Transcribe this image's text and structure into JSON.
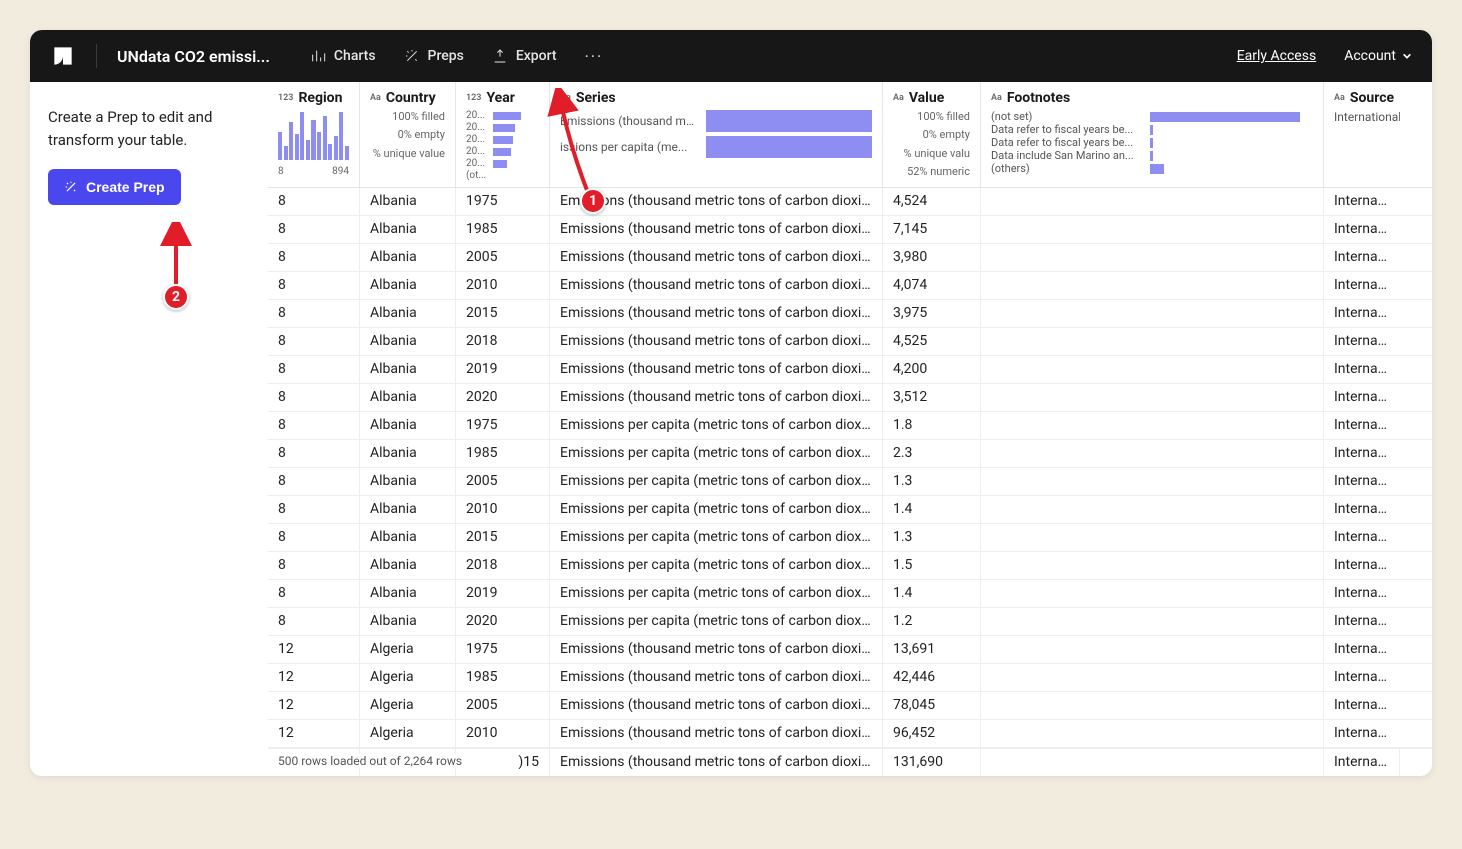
{
  "topbar": {
    "title": "UNdata CO2 emissi...",
    "nav": {
      "charts": "Charts",
      "preps": "Preps",
      "export": "Export"
    },
    "early_access": "Early Access",
    "account": "Account"
  },
  "sidebar": {
    "text": "Create a Prep to edit and transform your table.",
    "create_prep": "Create Prep"
  },
  "columns": {
    "region": {
      "label": "Region",
      "type": "123",
      "axis_min": "8",
      "axis_max": "894",
      "hist_heights": [
        28,
        14,
        38,
        26,
        48,
        20,
        40,
        28,
        44,
        16,
        24,
        48,
        14
      ]
    },
    "country": {
      "label": "Country",
      "type": "Aa",
      "stat1": "100% filled",
      "stat2": "0% empty",
      "stat3": "% unique value"
    },
    "year": {
      "label": "Year",
      "type": "123",
      "items": [
        {
          "lab": "20...",
          "bar": 28
        },
        {
          "lab": "20...",
          "bar": 22
        },
        {
          "lab": "20...",
          "bar": 20
        },
        {
          "lab": "20...",
          "bar": 18
        },
        {
          "lab": "20...",
          "bar": 14
        },
        {
          "lab": "(ot...",
          "bar": 0
        }
      ]
    },
    "series": {
      "label": "Series",
      "type": "Aa",
      "items": [
        {
          "lab": "Emissions (thousand met...",
          "grow": 1
        },
        {
          "lab": "issions per capita (me...",
          "grow": 1
        }
      ]
    },
    "value": {
      "label": "Value",
      "type": "Aa",
      "stat1": "100% filled",
      "stat2": "0% empty",
      "stat3": "% unique valu",
      "stat4": "52% numeric"
    },
    "footnotes": {
      "label": "Footnotes",
      "type": "Aa",
      "items": [
        {
          "lab": "(not set)",
          "bar": 150
        },
        {
          "lab": "Data refer to fiscal years be...",
          "bar": 3
        },
        {
          "lab": "Data refer to fiscal years be...",
          "bar": 3
        },
        {
          "lab": "Data include San Marino an...",
          "bar": 3
        },
        {
          "lab": "(others)",
          "bar": 14
        }
      ]
    },
    "source": {
      "label": "Source",
      "type": "Aa",
      "val": "International"
    }
  },
  "status": "500 rows loaded out of 2,264 rows",
  "status_row": {
    "year": ")15",
    "series": "Emissions (thousand metric tons of carbon dioxide)",
    "value": "131,690",
    "source": "Internation"
  },
  "annotations": {
    "marker1": "1",
    "marker2": "2"
  },
  "rows": [
    {
      "region": "8",
      "country": "Albania",
      "year": "1975",
      "series": "Emissions (thousand metric tons of carbon dioxide)",
      "value": "4,524",
      "footnotes": "",
      "source": "Internation"
    },
    {
      "region": "8",
      "country": "Albania",
      "year": "1985",
      "series": "Emissions (thousand metric tons of carbon dioxide)",
      "value": "7,145",
      "footnotes": "",
      "source": "Internation"
    },
    {
      "region": "8",
      "country": "Albania",
      "year": "2005",
      "series": "Emissions (thousand metric tons of carbon dioxide)",
      "value": "3,980",
      "footnotes": "",
      "source": "Internation"
    },
    {
      "region": "8",
      "country": "Albania",
      "year": "2010",
      "series": "Emissions (thousand metric tons of carbon dioxide)",
      "value": "4,074",
      "footnotes": "",
      "source": "Internation"
    },
    {
      "region": "8",
      "country": "Albania",
      "year": "2015",
      "series": "Emissions (thousand metric tons of carbon dioxide)",
      "value": "3,975",
      "footnotes": "",
      "source": "Internation"
    },
    {
      "region": "8",
      "country": "Albania",
      "year": "2018",
      "series": "Emissions (thousand metric tons of carbon dioxide)",
      "value": "4,525",
      "footnotes": "",
      "source": "Internation"
    },
    {
      "region": "8",
      "country": "Albania",
      "year": "2019",
      "series": "Emissions (thousand metric tons of carbon dioxide)",
      "value": "4,200",
      "footnotes": "",
      "source": "Internation"
    },
    {
      "region": "8",
      "country": "Albania",
      "year": "2020",
      "series": "Emissions (thousand metric tons of carbon dioxide)",
      "value": "3,512",
      "footnotes": "",
      "source": "Internation"
    },
    {
      "region": "8",
      "country": "Albania",
      "year": "1975",
      "series": "Emissions per capita (metric tons of carbon dioxide)",
      "value": "1.8",
      "footnotes": "",
      "source": "Internation"
    },
    {
      "region": "8",
      "country": "Albania",
      "year": "1985",
      "series": "Emissions per capita (metric tons of carbon dioxide)",
      "value": "2.3",
      "footnotes": "",
      "source": "Internation"
    },
    {
      "region": "8",
      "country": "Albania",
      "year": "2005",
      "series": "Emissions per capita (metric tons of carbon dioxide)",
      "value": "1.3",
      "footnotes": "",
      "source": "Internation"
    },
    {
      "region": "8",
      "country": "Albania",
      "year": "2010",
      "series": "Emissions per capita (metric tons of carbon dioxide)",
      "value": "1.4",
      "footnotes": "",
      "source": "Internation"
    },
    {
      "region": "8",
      "country": "Albania",
      "year": "2015",
      "series": "Emissions per capita (metric tons of carbon dioxide)",
      "value": "1.3",
      "footnotes": "",
      "source": "Internation"
    },
    {
      "region": "8",
      "country": "Albania",
      "year": "2018",
      "series": "Emissions per capita (metric tons of carbon dioxide)",
      "value": "1.5",
      "footnotes": "",
      "source": "Internation"
    },
    {
      "region": "8",
      "country": "Albania",
      "year": "2019",
      "series": "Emissions per capita (metric tons of carbon dioxide)",
      "value": "1.4",
      "footnotes": "",
      "source": "Internation"
    },
    {
      "region": "8",
      "country": "Albania",
      "year": "2020",
      "series": "Emissions per capita (metric tons of carbon dioxide)",
      "value": "1.2",
      "footnotes": "",
      "source": "Internation"
    },
    {
      "region": "12",
      "country": "Algeria",
      "year": "1975",
      "series": "Emissions (thousand metric tons of carbon dioxide)",
      "value": "13,691",
      "footnotes": "",
      "source": "Internation"
    },
    {
      "region": "12",
      "country": "Algeria",
      "year": "1985",
      "series": "Emissions (thousand metric tons of carbon dioxide)",
      "value": "42,446",
      "footnotes": "",
      "source": "Internation"
    },
    {
      "region": "12",
      "country": "Algeria",
      "year": "2005",
      "series": "Emissions (thousand metric tons of carbon dioxide)",
      "value": "78,045",
      "footnotes": "",
      "source": "Internation"
    },
    {
      "region": "12",
      "country": "Algeria",
      "year": "2010",
      "series": "Emissions (thousand metric tons of carbon dioxide)",
      "value": "96,452",
      "footnotes": "",
      "source": "Internation"
    }
  ]
}
